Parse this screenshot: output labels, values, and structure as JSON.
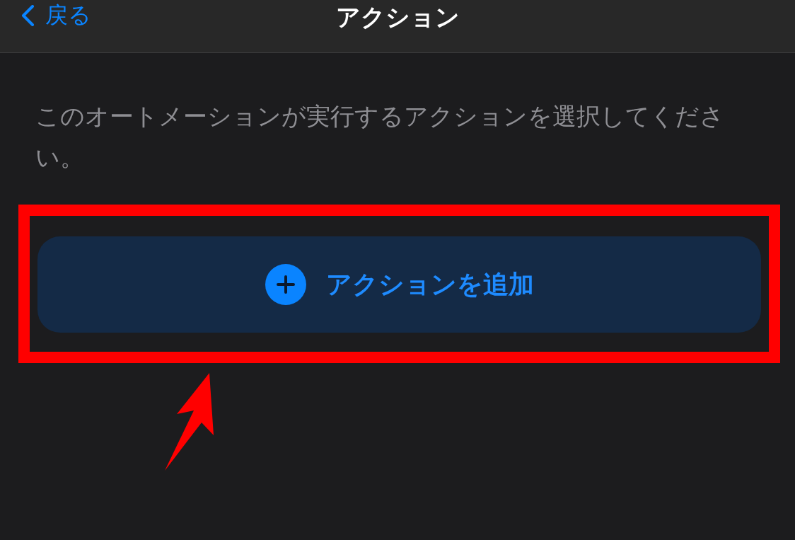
{
  "nav_bar": {
    "back_label": "戻る",
    "title": "アクション"
  },
  "description": "このオートメーションが実行するアクションを選択してください。",
  "add_button": {
    "label": "アクションを追加"
  }
}
